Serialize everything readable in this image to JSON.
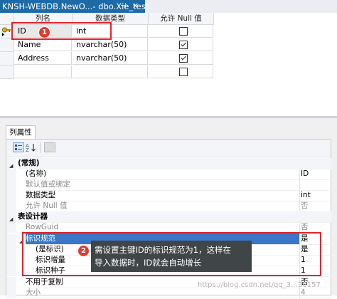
{
  "document_tab": {
    "title": "KNSH-WEBDB.NewO...- dbo.Xie_test",
    "pin_icon": "pin-icon",
    "close_icon": "close-icon"
  },
  "grid": {
    "headers": [
      "列名",
      "数据类型",
      "允许 Null 值"
    ],
    "rows": [
      {
        "name": "ID",
        "type": "int",
        "allow_null": false,
        "primary_key": true
      },
      {
        "name": "Name",
        "type": "nvarchar(50)",
        "allow_null": true,
        "primary_key": false
      },
      {
        "name": "Address",
        "type": "nvarchar(50)",
        "allow_null": true,
        "primary_key": false
      },
      {
        "name": "",
        "type": "",
        "allow_null": false,
        "primary_key": false
      }
    ]
  },
  "badges": {
    "one": "1",
    "two": "2"
  },
  "properties_tab": {
    "label": "列属性"
  },
  "properties": {
    "rows": [
      {
        "name": "(常规)",
        "value": "",
        "kind": "cat"
      },
      {
        "name": "(名称)",
        "value": "ID",
        "kind": "normal"
      },
      {
        "name": "默认值或绑定",
        "value": "",
        "kind": "dim"
      },
      {
        "name": "数据类型",
        "value": "int",
        "kind": "normal"
      },
      {
        "name": "允许 Null 值",
        "value": "否",
        "kind": "dim"
      },
      {
        "name": "表设计器",
        "value": "",
        "kind": "cat"
      },
      {
        "name": "RowGuid",
        "value": "否",
        "kind": "dim"
      },
      {
        "name": "标识规范",
        "value": "是",
        "kind": "selected"
      },
      {
        "name": "(是标识)",
        "value": "是",
        "kind": "sub"
      },
      {
        "name": "标识增量",
        "value": "1",
        "kind": "sub"
      },
      {
        "name": "标识种子",
        "value": "1",
        "kind": "sub"
      },
      {
        "name": "不用于复制",
        "value": "否",
        "kind": "normal"
      },
      {
        "name": "大小",
        "value": "4",
        "kind": "dim"
      }
    ]
  },
  "callout": {
    "line1": "需设置主键ID的标识规范为1，这样在",
    "line2": "导入数据时，ID就会自动增长"
  },
  "watermark": "https://blog.csdn.net/qq_3…36157",
  "colors": {
    "accent": "#1c6aa8",
    "annotation_red": "#e0242b",
    "selection": "#3a77c9"
  }
}
